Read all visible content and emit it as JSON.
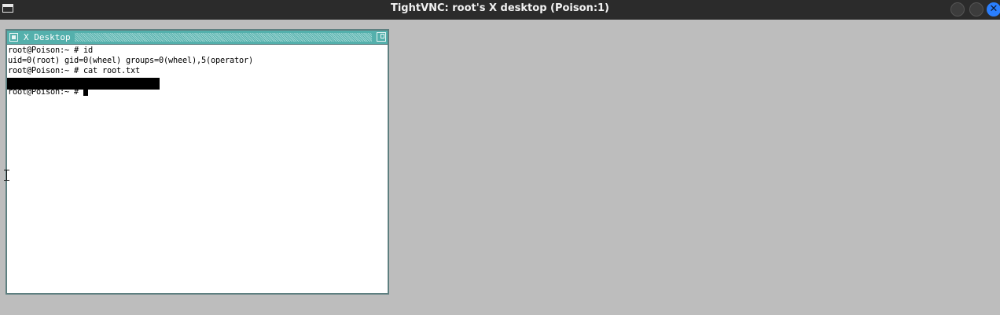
{
  "window": {
    "title": "TightVNC: root's X desktop (Poison:1)",
    "app_icon": "window-icon",
    "controls": {
      "minimize_icon": "circle-minimize-icon",
      "maximize_icon": "circle-maximize-icon",
      "close_glyph": "✕",
      "close_color": "#2a7fff"
    }
  },
  "xwindow": {
    "title": "X Desktop",
    "title_color": "#54b0ac"
  },
  "terminal": {
    "lines": [
      "root@Poison:~ # id",
      "uid=0(root) gid=0(wheel) groups=0(wheel),5(operator)",
      "root@Poison:~ # cat root.txt"
    ],
    "prompt": "root@Poison:~ # "
  }
}
